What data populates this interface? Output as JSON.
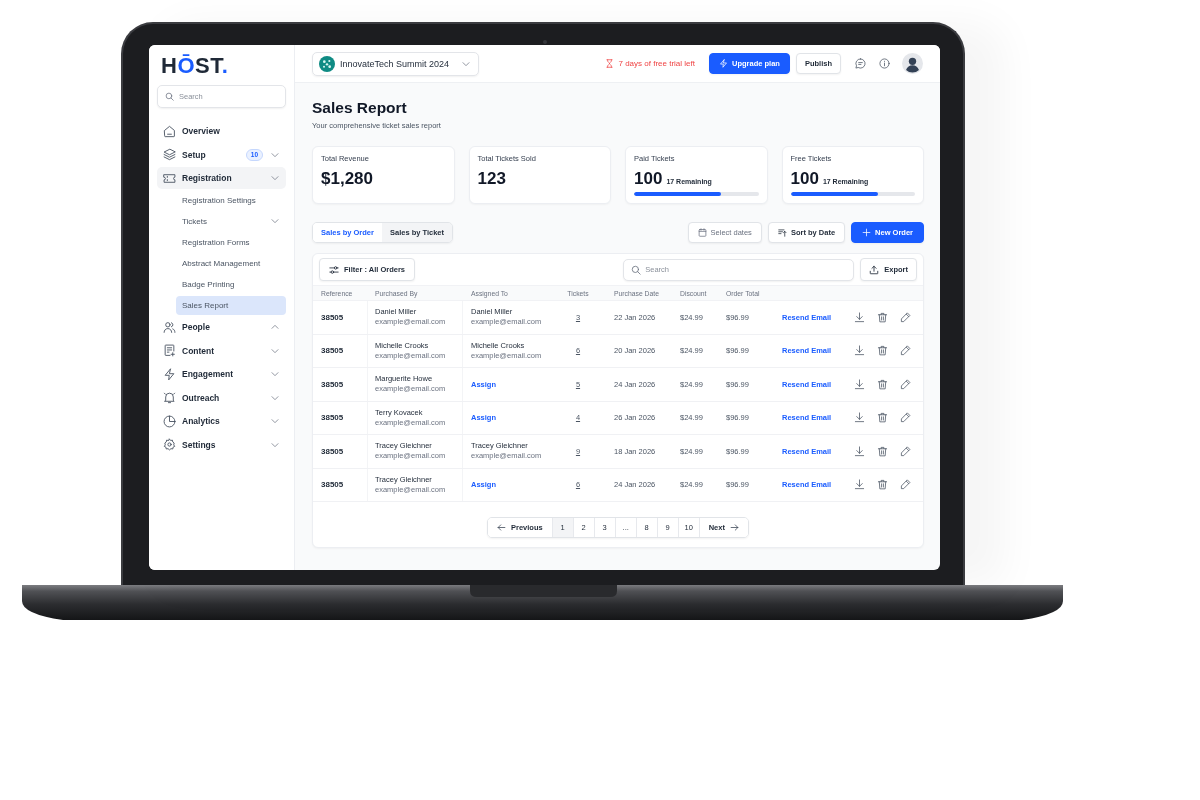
{
  "sidebar": {
    "logo": [
      {
        "text": "H",
        "accent": false
      },
      {
        "text": "Ō",
        "accent": true
      },
      {
        "text": "ST",
        "accent": false
      },
      {
        "text": ".",
        "accent": true
      }
    ],
    "search": {
      "placeholder": "Search"
    },
    "nav": [
      {
        "label": "Overview",
        "collapsible": false,
        "expanded": false
      },
      {
        "label": "Setup",
        "badge": "10",
        "collapsible": true,
        "chevron_up": false,
        "expanded": false
      },
      {
        "label": "Registration",
        "collapsible": true,
        "chevron_up": false,
        "expanded": true,
        "children": [
          {
            "label": "Registration Settings",
            "collapsible": false,
            "selected": false
          },
          {
            "label": "Tickets",
            "collapsible": true,
            "chevron_up": false,
            "selected": false
          },
          {
            "label": "Registration Forms",
            "collapsible": false,
            "selected": false
          },
          {
            "label": "Abstract Management",
            "collapsible": false,
            "selected": false
          },
          {
            "label": "Badge Printing",
            "collapsible": false,
            "selected": false
          },
          {
            "label": "Sales Report",
            "collapsible": false,
            "selected": true
          }
        ]
      },
      {
        "label": "People",
        "collapsible": true,
        "chevron_up": true,
        "expanded": false
      },
      {
        "label": "Content",
        "collapsible": true,
        "chevron_up": false,
        "expanded": false
      },
      {
        "label": "Engagement",
        "collapsible": true,
        "chevron_up": false,
        "expanded": false
      },
      {
        "label": "Outreach",
        "collapsible": true,
        "chevron_up": false,
        "expanded": false
      },
      {
        "label": "Analytics",
        "collapsible": true,
        "chevron_up": false,
        "expanded": false
      },
      {
        "label": "Settings",
        "collapsible": true,
        "chevron_up": false,
        "expanded": false
      }
    ]
  },
  "topbar": {
    "event": {
      "name": "InnovateTech Summit 2024"
    },
    "trial_notice": "7 days of free trial left",
    "buttons": [
      {
        "label": "Upgrade plan",
        "kind": "primary"
      },
      {
        "label": "Publish",
        "kind": "secondary"
      }
    ]
  },
  "page": {
    "title": "Sales Report",
    "subtitle": "Your comprehensive ticket sales report"
  },
  "stats": [
    {
      "label": "Total Revenue",
      "value": "$1,280"
    },
    {
      "label": "Total Tickets Sold",
      "value": "123"
    },
    {
      "label": "Paid Tickets",
      "value": "100",
      "note": "17 Remaining",
      "level": 0.7
    },
    {
      "label": "Free Tickets",
      "value": "100",
      "note": "17 Remaining",
      "level": 0.7
    }
  ],
  "view_tabs": [
    {
      "label": "Sales by Order",
      "selected": true
    },
    {
      "label": "Sales by Ticket",
      "selected": false
    }
  ],
  "actions": [
    {
      "label": "Select dates",
      "kind": "dates"
    },
    {
      "label": "Sort by Date",
      "kind": "sort"
    },
    {
      "label": "New Order",
      "kind": "create"
    }
  ],
  "table": {
    "filter": "Filter : All Orders",
    "search": {
      "placeholder": "Search"
    },
    "export": "Export",
    "columns": [
      "Reference",
      "Purchased By",
      "Assigned To",
      "Tickets",
      "Purchase Date",
      "Discount",
      "Order Total"
    ],
    "rows": [
      {
        "reference": "38505",
        "purchased_by": {
          "name": "Daniel Miller",
          "email": "example@email.com"
        },
        "assigned_to": {
          "kind": "person",
          "name": "Daniel Miller",
          "email": "example@email.com"
        },
        "tickets": "3",
        "purchase_date": "22 Jan 2026",
        "discount": "$24.99",
        "order_total": "$96.99",
        "action": "Resend Email"
      },
      {
        "reference": "38505",
        "purchased_by": {
          "name": "Michelle Crooks",
          "email": "example@email.com"
        },
        "assigned_to": {
          "kind": "person",
          "name": "Michelle Crooks",
          "email": "example@email.com"
        },
        "tickets": "6",
        "purchase_date": "20 Jan 2026",
        "discount": "$24.99",
        "order_total": "$96.99",
        "action": "Resend Email"
      },
      {
        "reference": "38505",
        "purchased_by": {
          "name": "Marguerite Howe",
          "email": "example@email.com"
        },
        "assigned_to": {
          "kind": "link",
          "label": "Assign"
        },
        "tickets": "5",
        "purchase_date": "24 Jan 2026",
        "discount": "$24.99",
        "order_total": "$96.99",
        "action": "Resend Email"
      },
      {
        "reference": "38505",
        "purchased_by": {
          "name": "Terry Kovacek",
          "email": "example@email.com"
        },
        "assigned_to": {
          "kind": "link",
          "label": "Assign"
        },
        "tickets": "4",
        "purchase_date": "26 Jan 2026",
        "discount": "$24.99",
        "order_total": "$96.99",
        "action": "Resend Email"
      },
      {
        "reference": "38505",
        "purchased_by": {
          "name": "Tracey Gleichner",
          "email": "example@email.com"
        },
        "assigned_to": {
          "kind": "person",
          "name": "Tracey Gleichner",
          "email": "example@email.com"
        },
        "tickets": "9",
        "purchase_date": "18 Jan 2026",
        "discount": "$24.99",
        "order_total": "$96.99",
        "action": "Resend Email"
      },
      {
        "reference": "38505",
        "purchased_by": {
          "name": "Tracey Gleichner",
          "email": "example@email.com"
        },
        "assigned_to": {
          "kind": "link",
          "label": "Assign"
        },
        "tickets": "6",
        "purchase_date": "24 Jan 2026",
        "discount": "$24.99",
        "order_total": "$96.99",
        "action": "Resend Email"
      }
    ]
  },
  "pagination": {
    "previous": "Previous",
    "pages": [
      {
        "label": "1",
        "selected": true
      },
      {
        "label": "2",
        "selected": false
      },
      {
        "label": "3",
        "selected": false
      },
      {
        "label": "...",
        "selected": false
      },
      {
        "label": "8",
        "selected": false
      },
      {
        "label": "9",
        "selected": false
      },
      {
        "label": "10",
        "selected": false
      }
    ],
    "next": "Next"
  }
}
